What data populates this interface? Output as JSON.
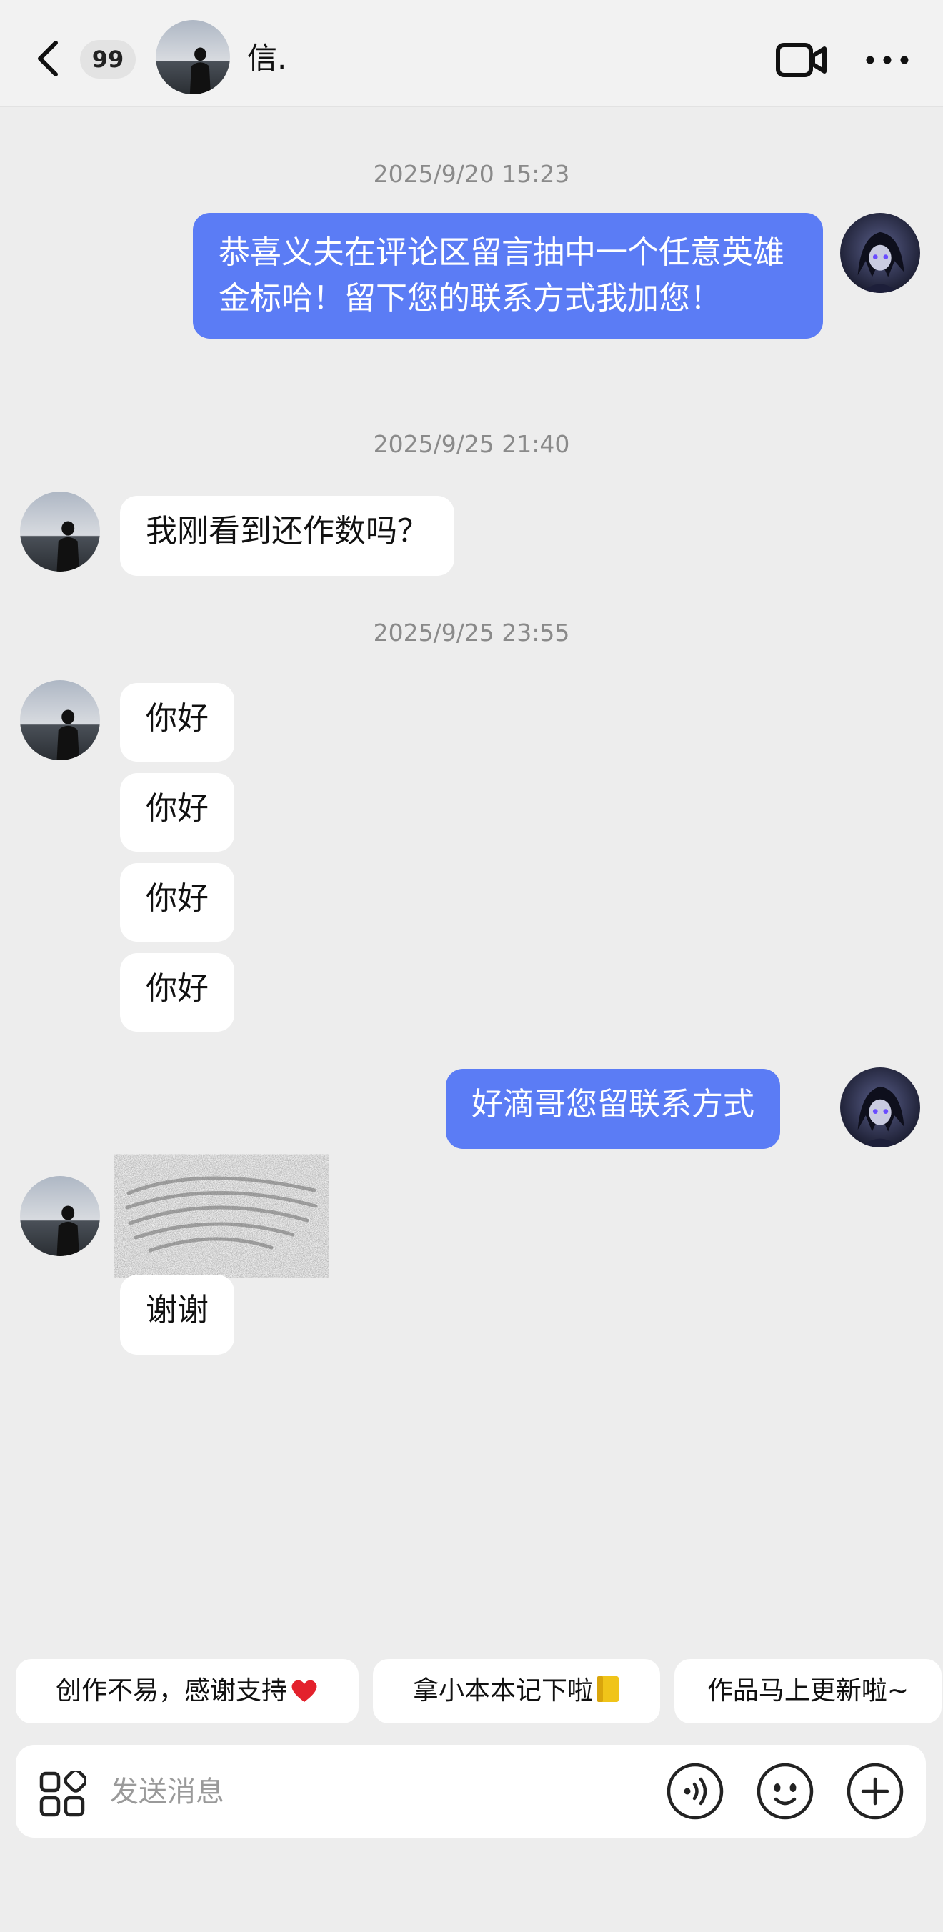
{
  "header": {
    "unread_count": "99",
    "contact_name": "信.",
    "icons": {
      "back": "chevron-left-icon",
      "video": "video-camera-icon",
      "more": "more-dots-icon"
    }
  },
  "timestamps": [
    "2025/9/20 15:23",
    "2025/9/25 21:40",
    "2025/9/25 23:55"
  ],
  "messages": [
    {
      "side": "out",
      "text": "恭喜义夫在评论区留言抽中一个任意英雄金标哈！留下您的联系方式我加您！"
    },
    {
      "side": "in",
      "text": "我刚看到还作数吗？"
    },
    {
      "side": "in",
      "text": "你好"
    },
    {
      "side": "in",
      "text": "你好"
    },
    {
      "side": "in",
      "text": "你好"
    },
    {
      "side": "in",
      "text": "你好"
    },
    {
      "side": "out",
      "text": "好滴哥您留联系方式"
    },
    {
      "side": "in",
      "type": "redacted-scribble"
    },
    {
      "side": "in",
      "text": "谢谢"
    }
  ],
  "quick_replies": [
    {
      "label": "创作不易，感谢支持",
      "icon": "red-heart-icon"
    },
    {
      "label": "拿小本本记下啦",
      "icon": "notebook-icon"
    },
    {
      "label": "作品马上更新啦~"
    }
  ],
  "composer": {
    "placeholder": "发送消息",
    "icons": [
      "apps-grid-icon",
      "voice-icon",
      "emoji-icon",
      "plus-icon"
    ]
  },
  "colors": {
    "background": "#ededed",
    "outgoing_bubble": "#5b7cf5",
    "incoming_bubble": "#ffffff",
    "timestamp_text": "#8a8a8a"
  }
}
